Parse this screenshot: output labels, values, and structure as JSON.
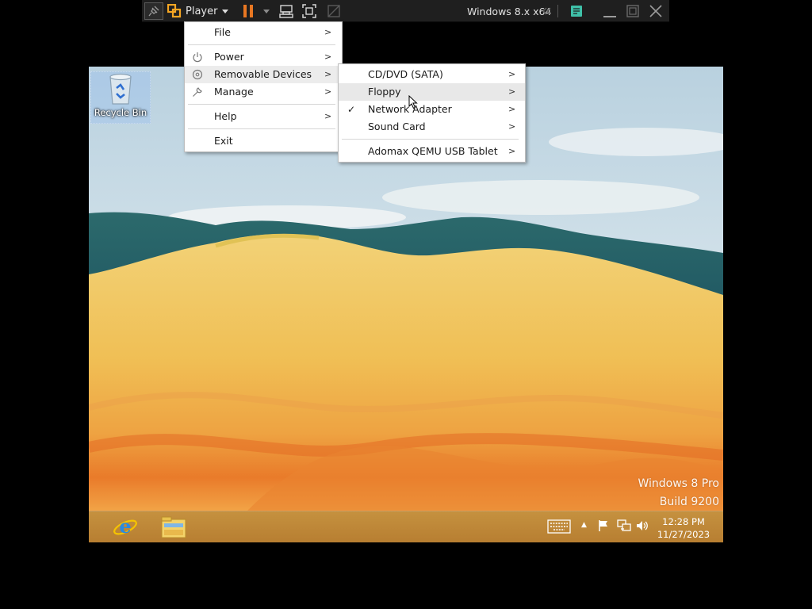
{
  "toolbar": {
    "player_label": "Player",
    "vm_name": "Windows 8.x x64",
    "icons": [
      "pin-icon",
      "vmware-logo-icon",
      "dropdown-arrow-icon",
      "pause-icon",
      "send-ctrl-alt-del-icon",
      "fullscreen-icon",
      "unity-icon",
      "rewind-icon",
      "note-icon",
      "minimize-icon",
      "restore-icon",
      "close-icon"
    ],
    "accent_pause": "#e87722",
    "accent_note": "#3fc0a8"
  },
  "player_menu": {
    "items": [
      {
        "label": "File"
      },
      {
        "label": "Power",
        "icon": "power-icon"
      },
      {
        "label": "Removable Devices",
        "icon": "disc-icon"
      },
      {
        "label": "Manage",
        "icon": "wrench-icon"
      },
      {
        "label": "Help"
      },
      {
        "label": "Exit"
      }
    ]
  },
  "devices_menu": {
    "items": [
      {
        "label": "CD/DVD (SATA)",
        "checked": false
      },
      {
        "label": "Floppy",
        "checked": false
      },
      {
        "label": "Network Adapter",
        "checked": true
      },
      {
        "label": "Sound Card",
        "checked": false
      },
      {
        "label": "Adomax QEMU USB Tablet",
        "checked": false
      }
    ]
  },
  "desktop": {
    "recycle_bin_label": "Recycle Bin",
    "watermark_line1": "Windows 8 Pro",
    "watermark_line2": "Build 9200"
  },
  "taskbar": {
    "pinned": [
      "internet-explorer-icon",
      "file-explorer-icon"
    ],
    "tray": [
      "keyboard-icon",
      "show-hidden-icons-icon",
      "action-center-flag-icon",
      "network-icon",
      "volume-icon"
    ],
    "time": "12:28 PM",
    "date": "11/27/2023",
    "color": "#bd8537"
  }
}
